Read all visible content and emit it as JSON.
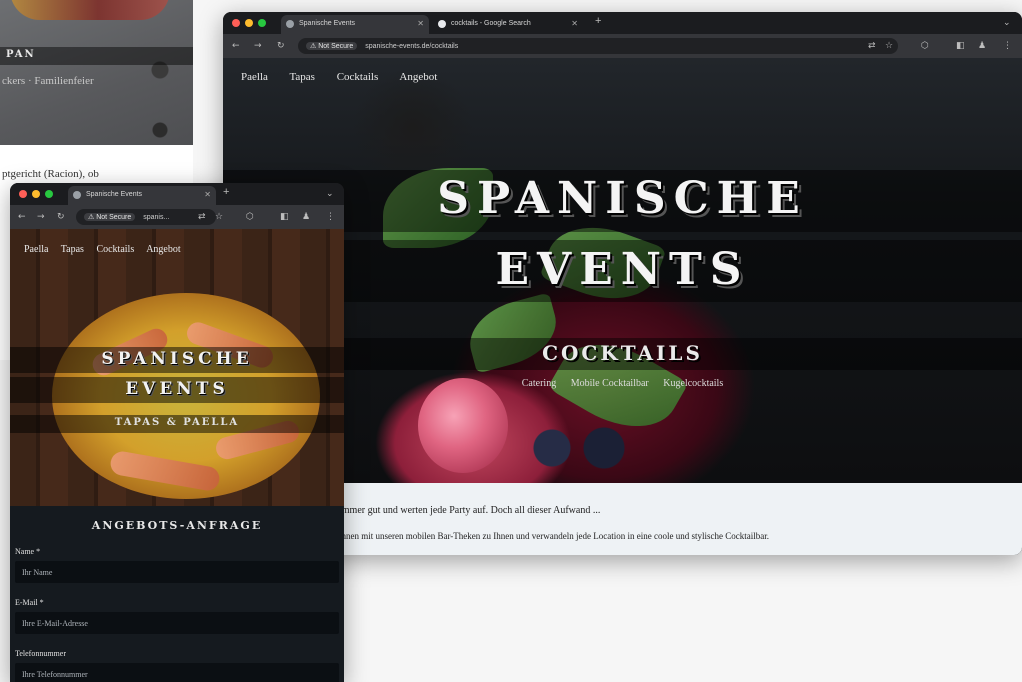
{
  "back_fragment": {
    "band_text": "PAN",
    "sub_links": "ckers · Familienfeier",
    "body_text": "ptgericht (Racion), ob"
  },
  "big_window": {
    "tabs": [
      {
        "label": "Spanische Events",
        "active": true
      },
      {
        "label": "cocktails - Google Search",
        "active": false
      }
    ],
    "address": {
      "security_badge": "Not Secure",
      "url": "spanische-events.de/cocktails"
    },
    "nav": [
      "Paella",
      "Tapas",
      "Cocktails",
      "Angebot"
    ],
    "hero": {
      "title_line1": "SPANISCHE",
      "title_line2": "EVENTS",
      "subtitle": "COCKTAILS",
      "categories": [
        "Catering",
        "Mobile Cocktailbar",
        "Kugelcocktails"
      ]
    },
    "content": {
      "line1": "immer gut und werten jede Party auf. Doch all dieser Aufwand ...",
      "line2": "ihnen mit unseren mobilen Bar-Theken zu Ihnen und verwandeln jede Location in eine coole und stylische Cocktailbar."
    }
  },
  "small_window": {
    "tabs": [
      {
        "label": "Spanische Events",
        "active": true
      }
    ],
    "address": {
      "security_badge": "Not Secure",
      "url": "spanis..."
    },
    "nav": [
      "Paella",
      "Tapas",
      "Cocktails",
      "Angebot"
    ],
    "hero": {
      "title_line1": "SPANISCHE",
      "title_line2": "EVENTS",
      "subtitle": "TAPAS & PAELLA"
    },
    "form": {
      "title": "ANGEBOTS-ANFRAGE",
      "fields": [
        {
          "label": "Name *",
          "placeholder": "Ihr Name"
        },
        {
          "label": "E-Mail *",
          "placeholder": "Ihre E-Mail-Adresse"
        },
        {
          "label": "Telefonnummer",
          "placeholder": "Ihre Telefonnummer"
        }
      ]
    }
  }
}
